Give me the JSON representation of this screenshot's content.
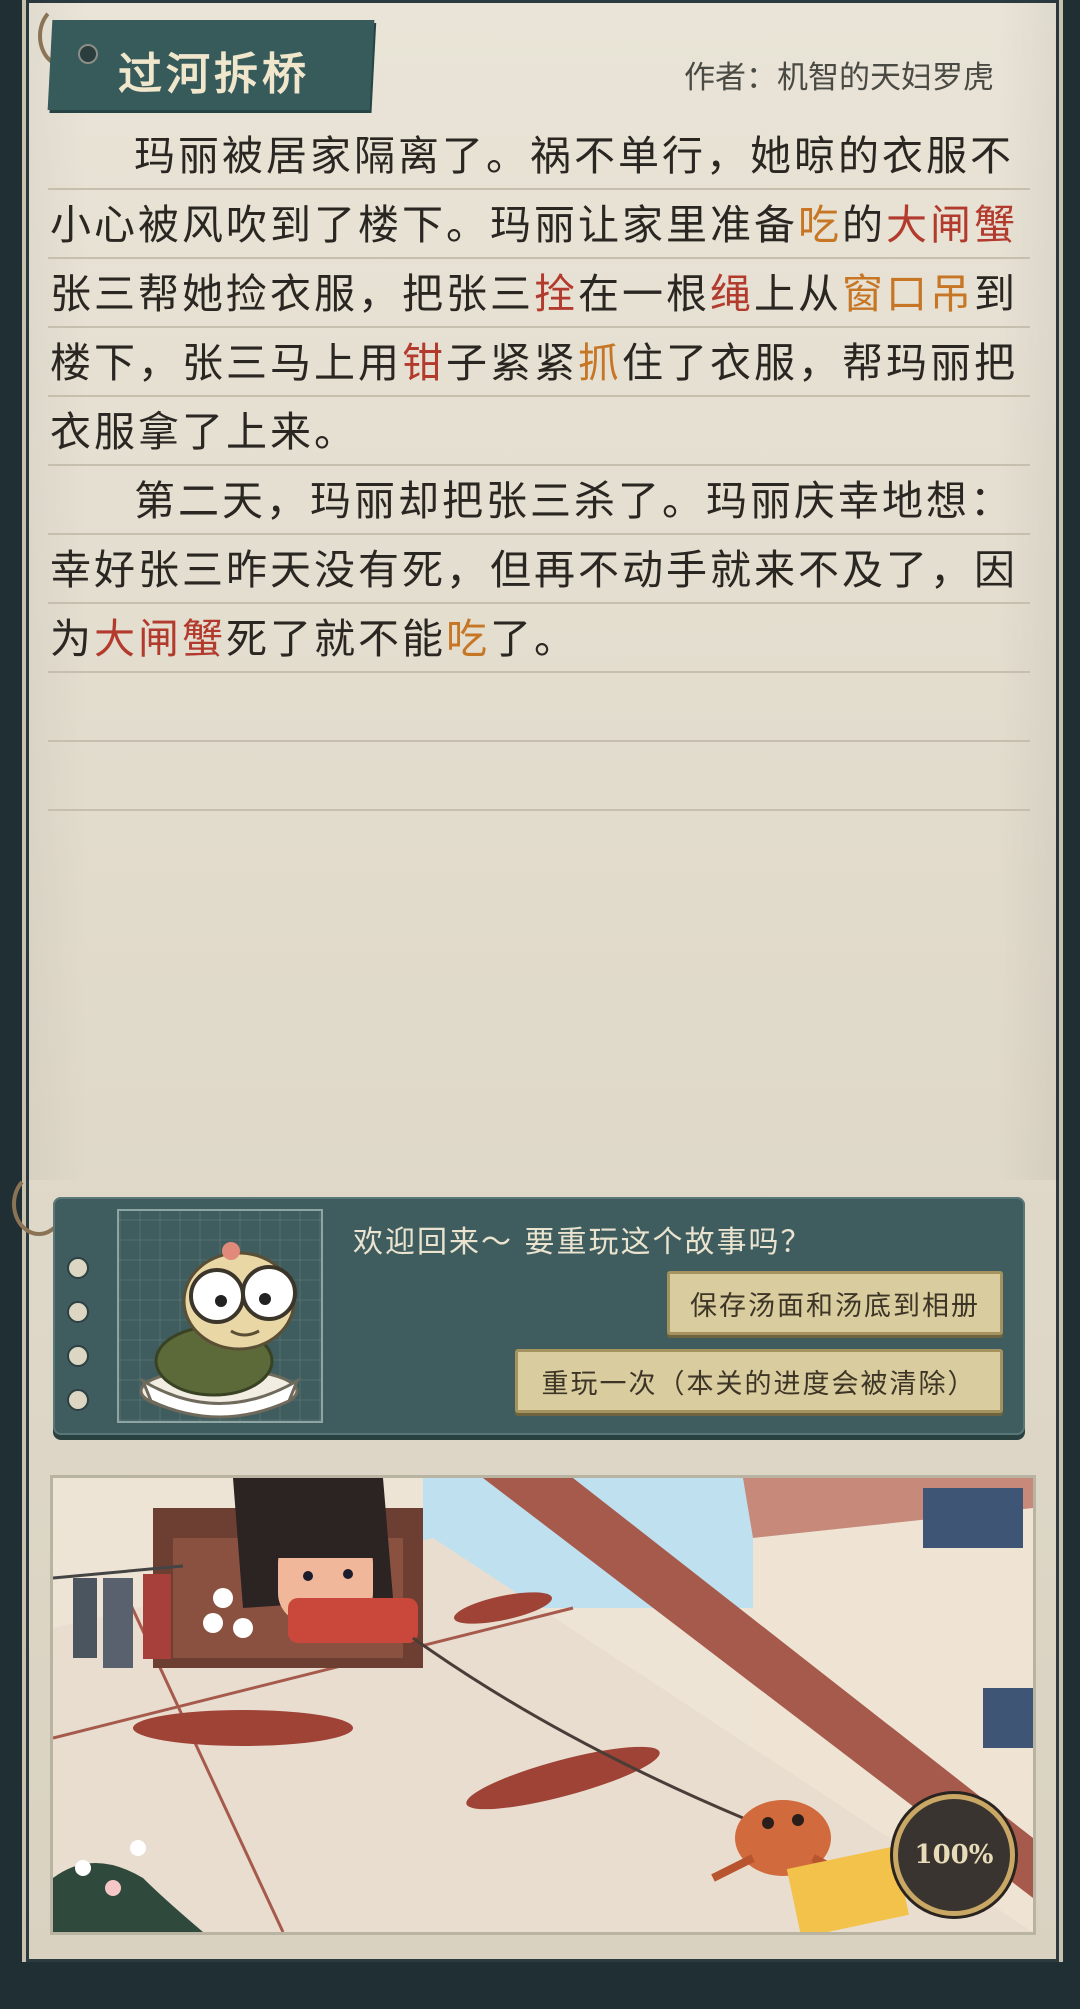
{
  "header": {
    "title": "过河拆桥",
    "author": "作者：机智的天妇罗虎"
  },
  "story": {
    "paragraphs": [
      [
        {
          "t": "玛丽被居家隔离了。祸不单行，她晾的衣服不小心被风吹到了楼下。玛丽让家里准备",
          "c": ""
        },
        {
          "t": "吃",
          "c": "orange"
        },
        {
          "t": "的",
          "c": ""
        },
        {
          "t": "大闸蟹",
          "c": "red"
        },
        {
          "t": "张三帮她捡衣服，把张三",
          "c": ""
        },
        {
          "t": "拴",
          "c": "red"
        },
        {
          "t": "在一根",
          "c": ""
        },
        {
          "t": "绳",
          "c": "red"
        },
        {
          "t": "上从",
          "c": ""
        },
        {
          "t": "窗口吊",
          "c": "orange"
        },
        {
          "t": "到楼下，张三马上用",
          "c": ""
        },
        {
          "t": "钳",
          "c": "red"
        },
        {
          "t": "子紧紧",
          "c": ""
        },
        {
          "t": "抓",
          "c": "orange"
        },
        {
          "t": "住了衣服，帮玛丽把衣服拿了上来。",
          "c": ""
        }
      ],
      [
        {
          "t": "第二天，玛丽却把张三杀了。玛丽庆幸地想：幸好张三昨天没有死，但再不动手就来不及了，因为",
          "c": ""
        },
        {
          "t": "大闸蟹",
          "c": "red"
        },
        {
          "t": "死了就不能",
          "c": ""
        },
        {
          "t": "吃",
          "c": "orange"
        },
        {
          "t": "了。",
          "c": ""
        }
      ]
    ]
  },
  "panel": {
    "welcome": "欢迎回来～ 要重玩这个故事吗？",
    "save_label": "保存汤面和汤底到相册",
    "replay_label": "重玩一次（本关的进度会被清除）"
  },
  "illustration": {
    "progress_label": "100%",
    "progress": 1.0
  },
  "colors": {
    "red_keyword": "#b23b2e",
    "orange_keyword": "#c67624",
    "panel_bg": "#3f5d5e",
    "button_bg": "#d9cc9f"
  }
}
